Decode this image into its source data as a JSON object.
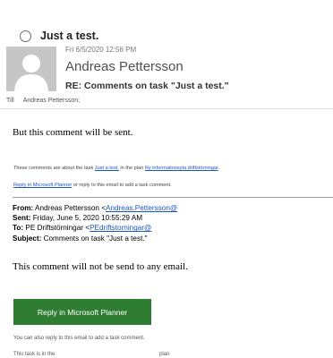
{
  "header": {
    "subject": "Just a test.",
    "date": "Fri 6/5/2020 12:56 PM",
    "sender": "Andreas Pettersson",
    "re_subject": "RE: Comments on task \"Just a test.\"",
    "to_label": "Till",
    "to_name": "Andreas Pettersson;"
  },
  "body": {
    "line1": "But this comment will be sent.",
    "note_prefix": "These comments are about the task ",
    "task_link": "Just a test.",
    "note_mid": " in the plan ",
    "plan_link": "Ny informationsyta driftstörningar",
    "note_suffix": ".",
    "planner_link": "Reply in Microsoft Planner",
    "planner_suffix": " or reply to this email to add a task comment.",
    "from_label": "From:",
    "from_name": " Andreas Pettersson <",
    "from_email": "Andreas.Pettersson@",
    "sent_label": "Sent:",
    "sent_value": " Friday, June 5, 2020 10:55:29 AM",
    "to_label": "To:",
    "to_name": " PE Driftstörningar <",
    "to_email": "PEdriftstorningar@",
    "subject_label": "Subject:",
    "subject_value": " Comments on task \"Just a test.\"",
    "line2": "This comment will not be send to any email.",
    "cta_label": "Reply in Microsoft Planner",
    "reply_note": "You can also reply to this email to add a task comment.",
    "task_note": "This task is in the",
    "task_note_plan": "plan"
  },
  "colors": {
    "cta_bg": "#2e7d32",
    "link": "#1a55c9"
  }
}
